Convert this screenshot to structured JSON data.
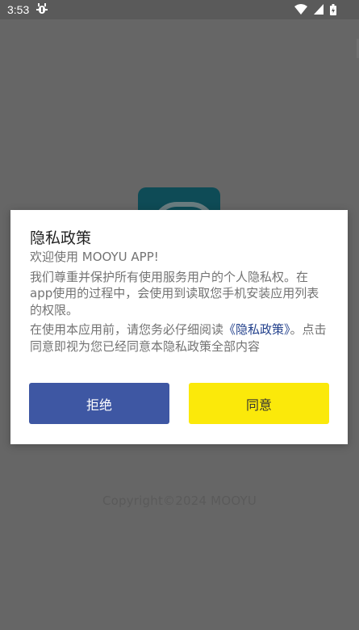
{
  "status_bar": {
    "time": "3:53",
    "icons": [
      "bug-icon",
      "wifi-icon",
      "signal-icon",
      "battery-charging-icon"
    ]
  },
  "app": {
    "logo_icon": "app-logo",
    "copyright": "Copyright©2024 MOOYU"
  },
  "dialog": {
    "title": "隐私政策",
    "line1": "欢迎使用 MOOYU APP!",
    "line2": "我们尊重并保护所有使用服务用户的个人隐私权。在app使用的过程中，会使用到读取您手机安装应用列表的权限。",
    "line3_before": "在使用本应用前，请您务必仔细阅读",
    "policy_link": "《隐私政策》",
    "line3_after": "。点击同意即视为您已经同意本隐私政策全部内容",
    "reject_label": "拒绝",
    "agree_label": "同意"
  },
  "colors": {
    "overlay": "#666666",
    "reject_button": "#3e57a3",
    "agree_button": "#fbe90a",
    "link": "#23418c",
    "logo": "#0e4b56"
  }
}
